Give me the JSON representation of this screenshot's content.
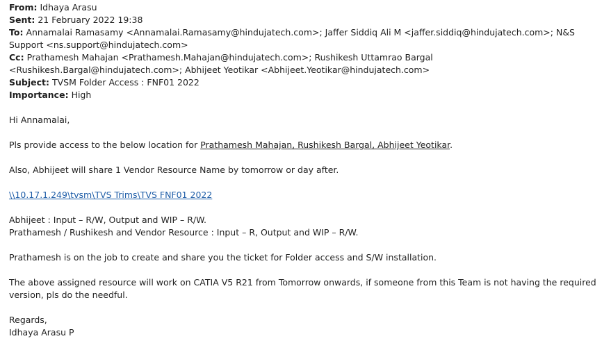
{
  "header": {
    "from_label": "From:",
    "from_value": "Idhaya Arasu",
    "sent_label": "Sent:",
    "sent_value": "21 February 2022 19:38",
    "to_label": "To:",
    "to_value": "Annamalai Ramasamy <Annamalai.Ramasamy@hindujatech.com>; Jaffer Siddiq Ali M <jaffer.siddiq@hindujatech.com>; N&S Support <ns.support@hindujatech.com>",
    "cc_label": "Cc:",
    "cc_value": "Prathamesh Mahajan <Prathamesh.Mahajan@hindujatech.com>; Rushikesh Uttamrao Bargal <Rushikesh.Bargal@hindujatech.com>; Abhijeet Yeotikar <Abhijeet.Yeotikar@hindujatech.com>",
    "subject_label": "Subject:",
    "subject_value": "TVSM Folder Access : FNF01 2022",
    "importance_label": "Importance:",
    "importance_value": "High"
  },
  "body": {
    "greeting": "Hi Annamalai,",
    "access_prefix": "Pls provide access to the below location for ",
    "access_names": "Prathamesh Mahajan, Rushikesh Bargal, Abhijeet Yeotikar",
    "access_suffix": ".",
    "vendor_line": "Also, Abhijeet will share 1 Vendor Resource Name by tomorrow or day after.",
    "path_link": "\\\\10.17.1.249\\tvsm\\TVS Trims\\TVS FNF01 2022",
    "perm_line1": "Abhijeet : Input – R/W, Output and WIP – R/W.",
    "perm_line2": "Prathamesh / Rushikesh and Vendor Resource : Input – R, Output and WIP – R/W.",
    "ticket_line": "Prathamesh is on the job to create and share you the ticket for Folder access and S/W installation.",
    "catia_line": "The above assigned resource will work on CATIA V5 R21 from Tomorrow onwards, if someone from this Team is not having the required version, pls do the needful.",
    "regards": "Regards,",
    "signature": "Idhaya Arasu P"
  },
  "colors": {
    "text": "#1f1f1f",
    "link": "#1f5ea8",
    "background": "#ffffff"
  }
}
